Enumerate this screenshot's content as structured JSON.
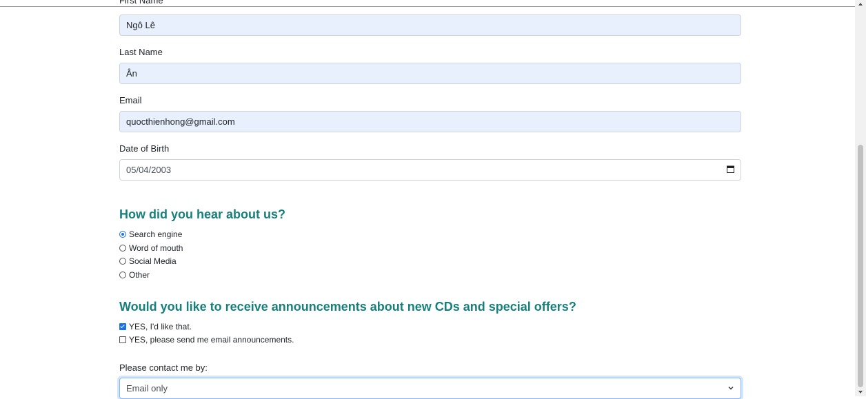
{
  "form": {
    "first_name": {
      "label": "First Name",
      "value": "Ngô Lê"
    },
    "last_name": {
      "label": "Last Name",
      "value": "Ân"
    },
    "email": {
      "label": "Email",
      "value": "quocthienhong@gmail.com"
    },
    "dob": {
      "label": "Date of Birth",
      "value": "05/04/2003",
      "icon": "calendar-icon"
    }
  },
  "hear": {
    "heading": "How did you hear about us?",
    "options": [
      {
        "label": "Search engine",
        "selected": true
      },
      {
        "label": "Word of mouth",
        "selected": false
      },
      {
        "label": "Social Media",
        "selected": false
      },
      {
        "label": "Other",
        "selected": false
      }
    ]
  },
  "announce": {
    "heading": "Would you like to receive announcements about new CDs and special offers?",
    "options": [
      {
        "label": "YES, I'd like that.",
        "checked": true
      },
      {
        "label": "YES, please send me email announcements.",
        "checked": false
      }
    ]
  },
  "contact": {
    "label": "Please contact me by:",
    "selected": "Email only",
    "icon": "chevron-down-icon"
  },
  "colors": {
    "heading": "#17807c",
    "accent": "#1a73e8",
    "autofill": "#e8f0fe"
  }
}
